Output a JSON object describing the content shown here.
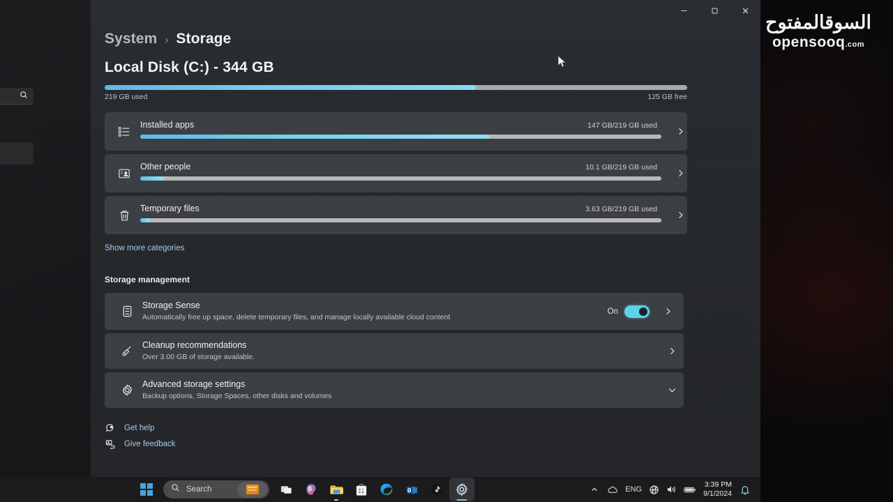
{
  "window": {
    "controls": [
      {
        "name": "minimize",
        "glyph": "minimize-icon"
      },
      {
        "name": "restore",
        "glyph": "restore-icon"
      },
      {
        "name": "close",
        "glyph": "close-icon"
      }
    ]
  },
  "breadcrumb": {
    "parent": "System",
    "separator": "›",
    "current": "Storage"
  },
  "disk": {
    "title": "Local Disk (C:) - 344 GB",
    "used_label": "219 GB used",
    "free_label": "125 GB free",
    "used_percent": 63.7
  },
  "categories": [
    {
      "icon": "list-icon",
      "title": "Installed apps",
      "value": "147 GB/219 GB used",
      "percent": 67.1,
      "chevron": "chevron-right-icon"
    },
    {
      "icon": "other-people-icon",
      "title": "Other people",
      "value": "10.1 GB/219 GB used",
      "percent": 4.6,
      "chevron": "chevron-right-icon"
    },
    {
      "icon": "trash-icon",
      "title": "Temporary files",
      "value": "3.63 GB/219 GB used",
      "percent": 2.0,
      "chevron": "chevron-right-icon"
    }
  ],
  "show_more_label": "Show more categories",
  "management": {
    "section_title": "Storage management",
    "items": [
      {
        "icon": "drive-icon",
        "title": "Storage Sense",
        "subtitle": "Automatically free up space, delete temporary files, and manage locally available cloud content",
        "toggle_label": "On",
        "toggle_on": true,
        "chevron": "chevron-right-icon"
      },
      {
        "icon": "broom-icon",
        "title": "Cleanup recommendations",
        "subtitle": "Over 3.00 GB of storage available.",
        "chevron": "chevron-right-icon"
      },
      {
        "icon": "gear-icon",
        "title": "Advanced storage settings",
        "subtitle": "Backup options, Storage Spaces, other disks and volumes",
        "chevron": "chevron-down-icon"
      }
    ]
  },
  "footer": [
    {
      "icon": "help-icon",
      "label": "Get help"
    },
    {
      "icon": "feedback-icon",
      "label": "Give feedback"
    }
  ],
  "taskbar": {
    "start": "start-icon",
    "search": {
      "placeholder": "Search",
      "icon": "search-icon",
      "widget": "widget-thumbnail"
    },
    "items": [
      {
        "name": "task-view",
        "icon": "task-view-icon",
        "running": false,
        "active": false
      },
      {
        "name": "copilot",
        "icon": "copilot-icon",
        "running": false,
        "active": false
      },
      {
        "name": "file-explorer",
        "icon": "file-explorer-icon",
        "running": true,
        "active": false
      },
      {
        "name": "microsoft-store",
        "icon": "store-icon",
        "running": false,
        "active": false
      },
      {
        "name": "edge",
        "icon": "edge-icon",
        "running": false,
        "active": false
      },
      {
        "name": "outlook",
        "icon": "outlook-icon",
        "running": false,
        "active": false
      },
      {
        "name": "tiktok",
        "icon": "tiktok-icon",
        "running": false,
        "active": false
      },
      {
        "name": "settings",
        "icon": "settings-gear-icon",
        "running": false,
        "active": true
      }
    ],
    "tray": {
      "chevron": "chevron-up-icon",
      "onedrive": "onedrive-icon",
      "language": "ENG",
      "network": "network-icon",
      "volume": "volume-icon",
      "battery": "battery-icon",
      "time": "3:39 PM",
      "date": "9/1/2024",
      "notifications": "bell-icon"
    }
  },
  "watermark": {
    "arabic": "السوقالمفتوح",
    "english": "opensooq",
    "domain": ".com"
  },
  "colors": {
    "accent": "#6fc4e8",
    "bar_used": "#7bd3ef",
    "bar_free": "#b8b8b8",
    "card": "#3b3e42",
    "link": "#a8cdec"
  }
}
